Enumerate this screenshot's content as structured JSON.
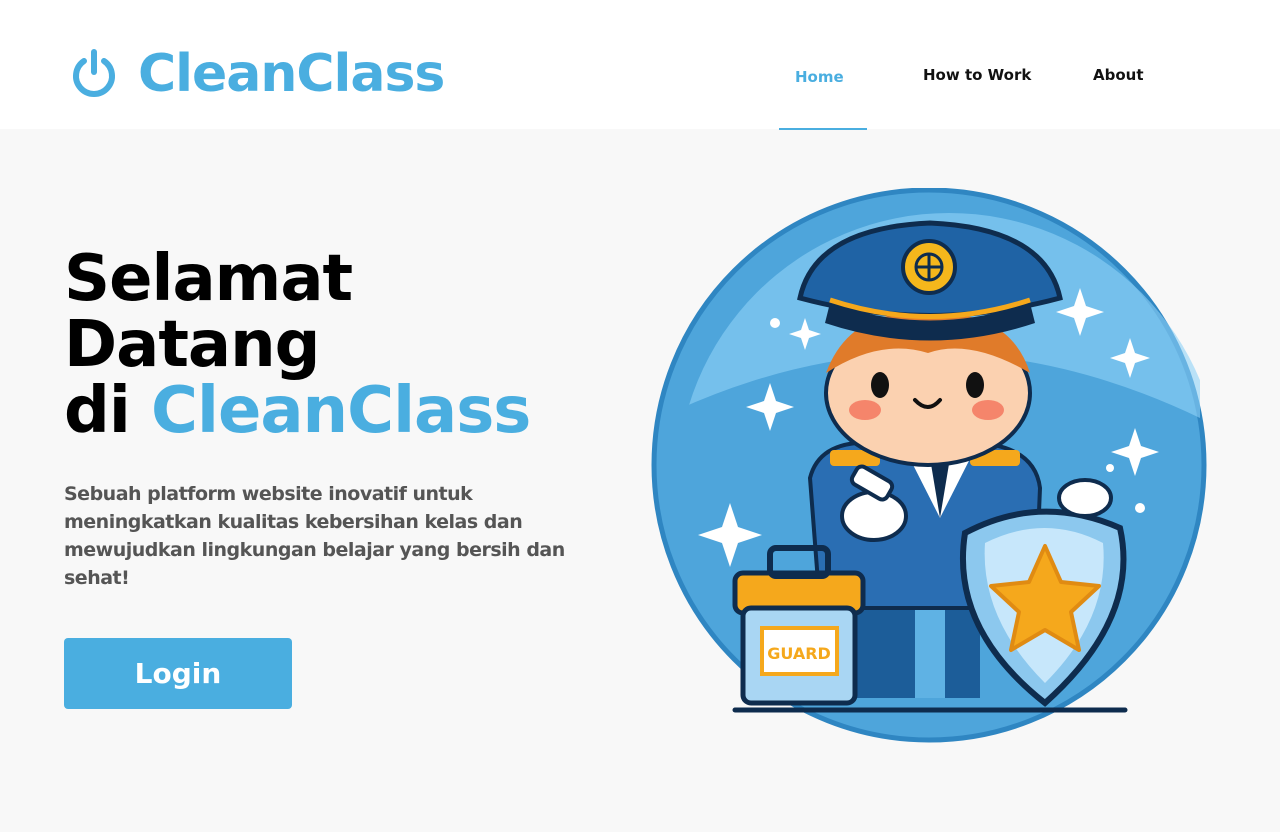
{
  "brand": {
    "name": "CleanClass",
    "color": "#4aaee0",
    "logo_icon": "power-icon"
  },
  "nav": [
    {
      "label": "Home",
      "active": true
    },
    {
      "label": "How to Work",
      "active": false
    },
    {
      "label": "About",
      "active": false
    }
  ],
  "hero": {
    "title_line1": "Selamat",
    "title_line2": "Datang",
    "title_line3_prefix": "di ",
    "title_line3_accent": "CleanClass",
    "description": "Sebuah platform website inovatif untuk meningkatkan kualitas kebersihan kelas dan mewujudkan lingkungan belajar yang bersih dan sehat!",
    "cta_label": "Login",
    "illustration": {
      "name": "guard-mascot-illustration",
      "bag_label": "GUARD"
    }
  }
}
